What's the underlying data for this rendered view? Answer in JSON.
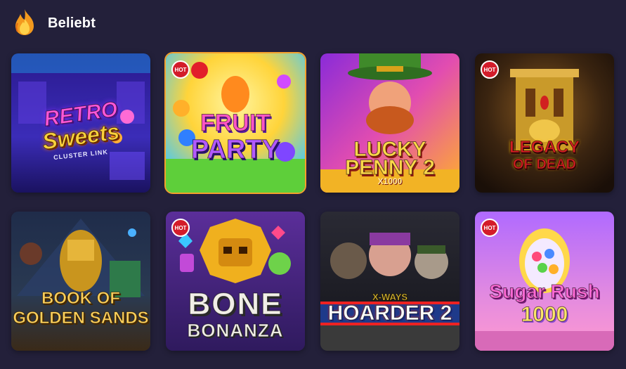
{
  "section": {
    "title": "Beliebt",
    "icon": "flame-icon"
  },
  "games": [
    {
      "id": "retro-sweets",
      "title_line1": "RETRO",
      "title_line2": "Sweets",
      "subtitle": "CLUSTER LINK",
      "hot": false
    },
    {
      "id": "fruit-party",
      "title_line1": "FRUIT",
      "title_line2": "PARTY",
      "badge": "HOT",
      "hot": true
    },
    {
      "id": "lucky-penny-2",
      "title_line1": "LUCKY",
      "title_line2": "PENNY 2",
      "subtitle": "X1000",
      "hot": false
    },
    {
      "id": "legacy-of-dead",
      "title_line1": "LEGACY",
      "title_line2": "OF DEAD",
      "badge": "HOT",
      "hot": true
    },
    {
      "id": "book-of-golden-sands",
      "title_line1": "BOOK OF",
      "title_line2": "GOLDEN SANDS",
      "hot": false
    },
    {
      "id": "bone-bonanza",
      "title_line1": "BONE",
      "title_line2": "BONANZA",
      "badge": "HOT",
      "hot": true
    },
    {
      "id": "hoarder-2",
      "title_line1": "X-WAYS",
      "title_line2": "HOARDER 2",
      "hot": false
    },
    {
      "id": "sugar-rush-1000",
      "title_line1": "Sugar Rush",
      "title_line2": "1000",
      "badge": "HOT",
      "hot": true
    }
  ],
  "colors": {
    "background": "#23203a",
    "hot_badge": "#d31c2a"
  }
}
